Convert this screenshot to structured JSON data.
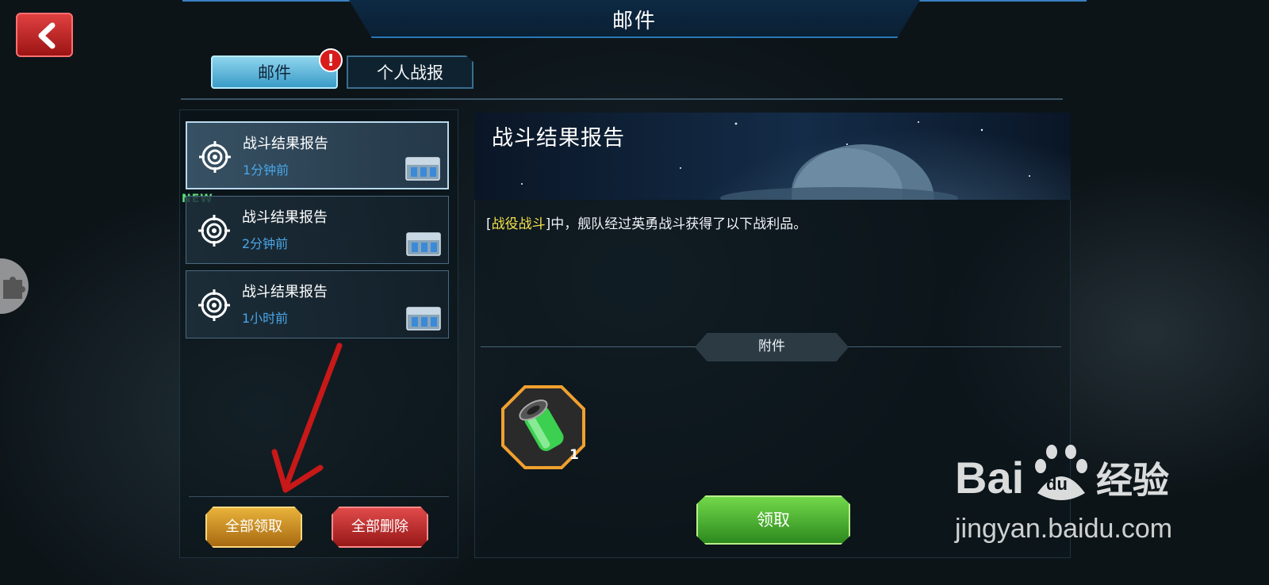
{
  "header": {
    "title": "邮件",
    "back_icon": "chevron-left-icon"
  },
  "tabs": [
    {
      "label": "邮件",
      "active": true,
      "alert": "!"
    },
    {
      "label": "个人战报",
      "active": false
    }
  ],
  "mail_list": {
    "new_badge": "NEW",
    "items": [
      {
        "title": "战斗结果报告",
        "time": "1分钟前",
        "icon": "target-icon",
        "attachment_icon": "chest-icon",
        "selected": true
      },
      {
        "title": "战斗结果报告",
        "time": "2分钟前",
        "icon": "target-icon",
        "attachment_icon": "chest-icon",
        "selected": false
      },
      {
        "title": "战斗结果报告",
        "time": "1小时前",
        "icon": "target-icon",
        "attachment_icon": "chest-icon",
        "selected": false
      }
    ],
    "claim_all_label": "全部领取",
    "delete_all_label": "全部删除"
  },
  "detail": {
    "title": "战斗结果报告",
    "body_open_bracket": "[",
    "body_highlight": "战役战斗",
    "body_rest": "]中，舰队经过英勇战斗获得了以下战利品。",
    "attachment_label": "附件",
    "reward": {
      "icon": "energy-canister-icon",
      "count": "1"
    },
    "claim_label": "领取"
  },
  "watermark": {
    "brand": "Bai du 经验",
    "url": "jingyan.baidu.com"
  },
  "colors": {
    "accent_blue": "#4aa6e8",
    "claim_green": "#72d84a",
    "gold": "#e8b23a",
    "red": "#e04a4a",
    "highlight_yellow": "#f3e24a"
  }
}
